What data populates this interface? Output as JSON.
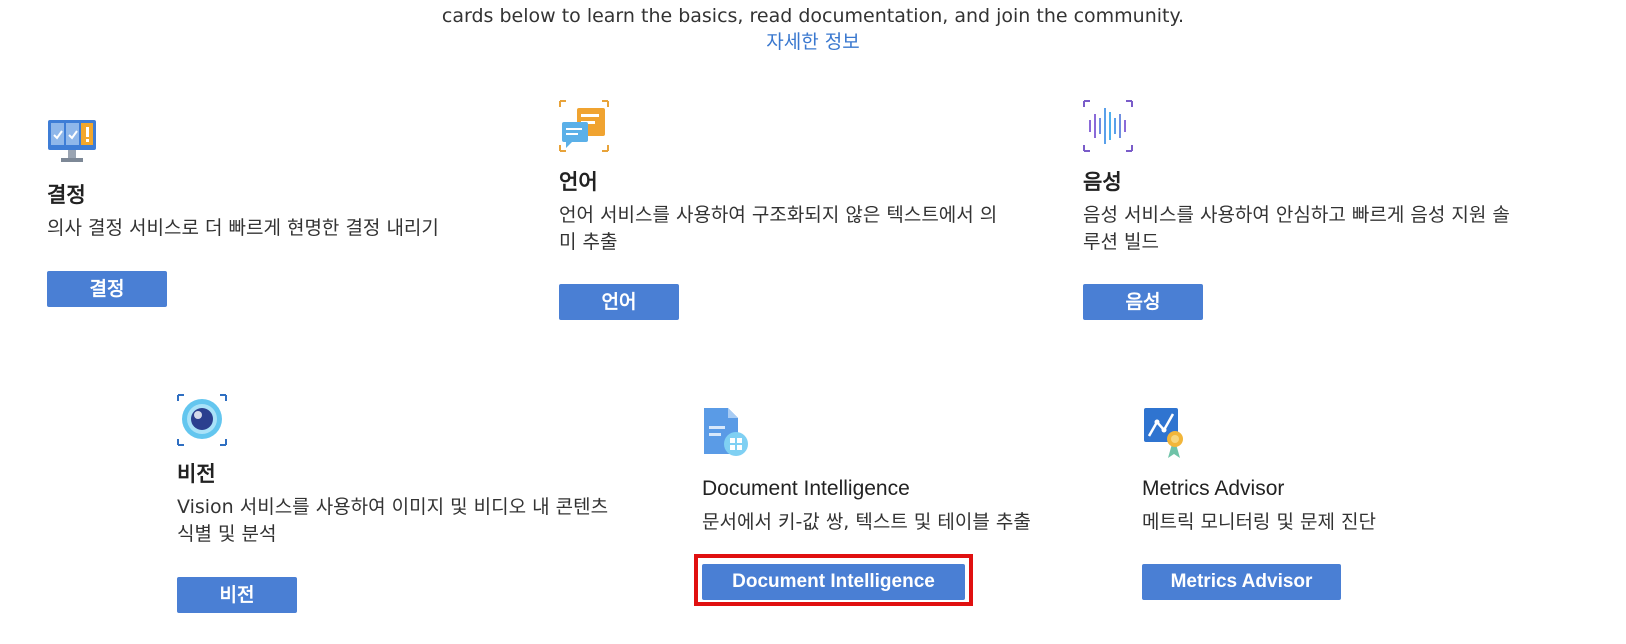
{
  "intro": {
    "text": "cards below to learn the basics, read documentation, and join the community.",
    "link": "자세한 정보"
  },
  "cards": [
    {
      "title": "결정",
      "desc": "의사 결정 서비스로 더 빠르게 현명한 결정 내리기",
      "button": "결정",
      "icon": "decision-monitor-icon"
    },
    {
      "title": "언어",
      "desc": "언어 서비스를 사용하여 구조화되지 않은 텍스트에서 의미 추출",
      "button": "언어",
      "icon": "language-chat-icon"
    },
    {
      "title": "음성",
      "desc": "음성 서비스를 사용하여 안심하고 빠르게 음성 지원 솔루션 빌드",
      "button": "음성",
      "icon": "speech-waveform-icon"
    },
    {
      "title": "비전",
      "desc": "Vision 서비스를 사용하여 이미지 및 비디오 내 콘텐츠 식별 및 분석",
      "button": "비전",
      "icon": "vision-eye-icon"
    },
    {
      "title": "Document Intelligence",
      "desc": "문서에서 키-값 쌍, 텍스트 및 테이블 추출",
      "button": "Document Intelligence",
      "icon": "document-grid-icon"
    },
    {
      "title": "Metrics Advisor",
      "desc": "메트릭 모니터링 및 문제 진단",
      "button": "Metrics Advisor",
      "icon": "metrics-ribbon-icon"
    }
  ],
  "colors": {
    "accent": "#4a7fd4",
    "link": "#3a78cf",
    "highlight": "#e01010"
  }
}
